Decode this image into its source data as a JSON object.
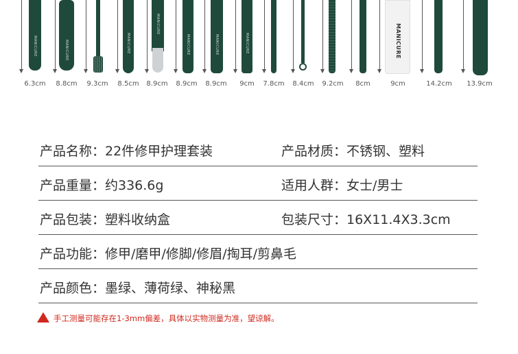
{
  "tools": [
    {
      "length": "6.3cm",
      "brand": "MANICURE"
    },
    {
      "length": "8.8cm",
      "brand": "MANICURE"
    },
    {
      "length": "9.3cm",
      "brand": ""
    },
    {
      "length": "8.5cm",
      "brand": "MANICURE"
    },
    {
      "length": "8.9cm",
      "brand": "MANICURE"
    },
    {
      "length": "8.9cm",
      "brand": "MANICURE"
    },
    {
      "length": "8.9cm",
      "brand": "MANICURE"
    },
    {
      "length": "9cm",
      "brand": "MANICURE"
    },
    {
      "length": "7.8cm",
      "brand": ""
    },
    {
      "length": "8.4cm",
      "brand": ""
    },
    {
      "length": "9.2cm",
      "brand": ""
    },
    {
      "length": "8cm",
      "brand": ""
    },
    {
      "length": "9cm",
      "brand": "MANICURE"
    },
    {
      "length": "14.2cm",
      "brand": ""
    },
    {
      "length": "13.9cm",
      "brand": ""
    }
  ],
  "specs": {
    "row1": {
      "l": "产品名称：22件修甲护理套装",
      "r": "产品材质：不锈钢、塑料"
    },
    "row2": {
      "l": "产品重量：约336.6g",
      "r": "适用人群：女士/男士"
    },
    "row3": {
      "l": "产品包装：塑料收纳盒",
      "r": "包装尺寸：16X11.4X3.3cm"
    },
    "row4": {
      "l": "产品功能：修甲/磨甲/修脚/修眉/掏耳/剪鼻毛"
    },
    "row5": {
      "l": "产品颜色：墨绿、薄荷绿、神秘黑"
    }
  },
  "note": "手工测量可能存在1-3mm偏差，具体以实物测量为准，望谅解。",
  "colors": {
    "tool": "#1f4a3b",
    "warning": "#d0281e"
  }
}
